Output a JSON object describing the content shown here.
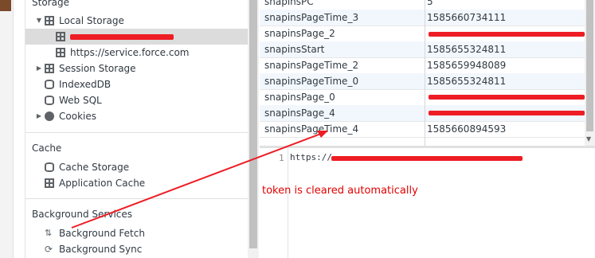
{
  "sidebar": {
    "storage_title": "Storage",
    "local_storage": "Local Storage",
    "local_origin_2": "https://service.force.com",
    "session_storage": "Session Storage",
    "indexeddb": "IndexedDB",
    "websql": "Web SQL",
    "cookies": "Cookies",
    "cache_title": "Cache",
    "cache_storage": "Cache Storage",
    "application_cache": "Application Cache",
    "bg_title": "Background Services",
    "bg_fetch": "Background Fetch",
    "bg_sync": "Background Sync"
  },
  "table": {
    "rows": [
      {
        "key": "snapinsPC",
        "value": "5"
      },
      {
        "key": "snapinsPageTime_3",
        "value": "1585660734111"
      },
      {
        "key": "snapinsPage_2",
        "value": ""
      },
      {
        "key": "snapinsStart",
        "value": "1585655324811"
      },
      {
        "key": "snapinsPageTime_2",
        "value": "1585659948089"
      },
      {
        "key": "snapinsPageTime_0",
        "value": "1585655324811"
      },
      {
        "key": "snapinsPage_0",
        "value": ""
      },
      {
        "key": "snapinsPage_4",
        "value": ""
      },
      {
        "key": "snapinsPageTime_4",
        "value": "1585660894593"
      }
    ]
  },
  "preview": {
    "line_number": "1",
    "code": "https://",
    "annotation": "token is cleared automatically"
  },
  "colors": {
    "annotation": "#e00000",
    "redaction": "#ee1c24",
    "selected": "#dcdcdc"
  }
}
